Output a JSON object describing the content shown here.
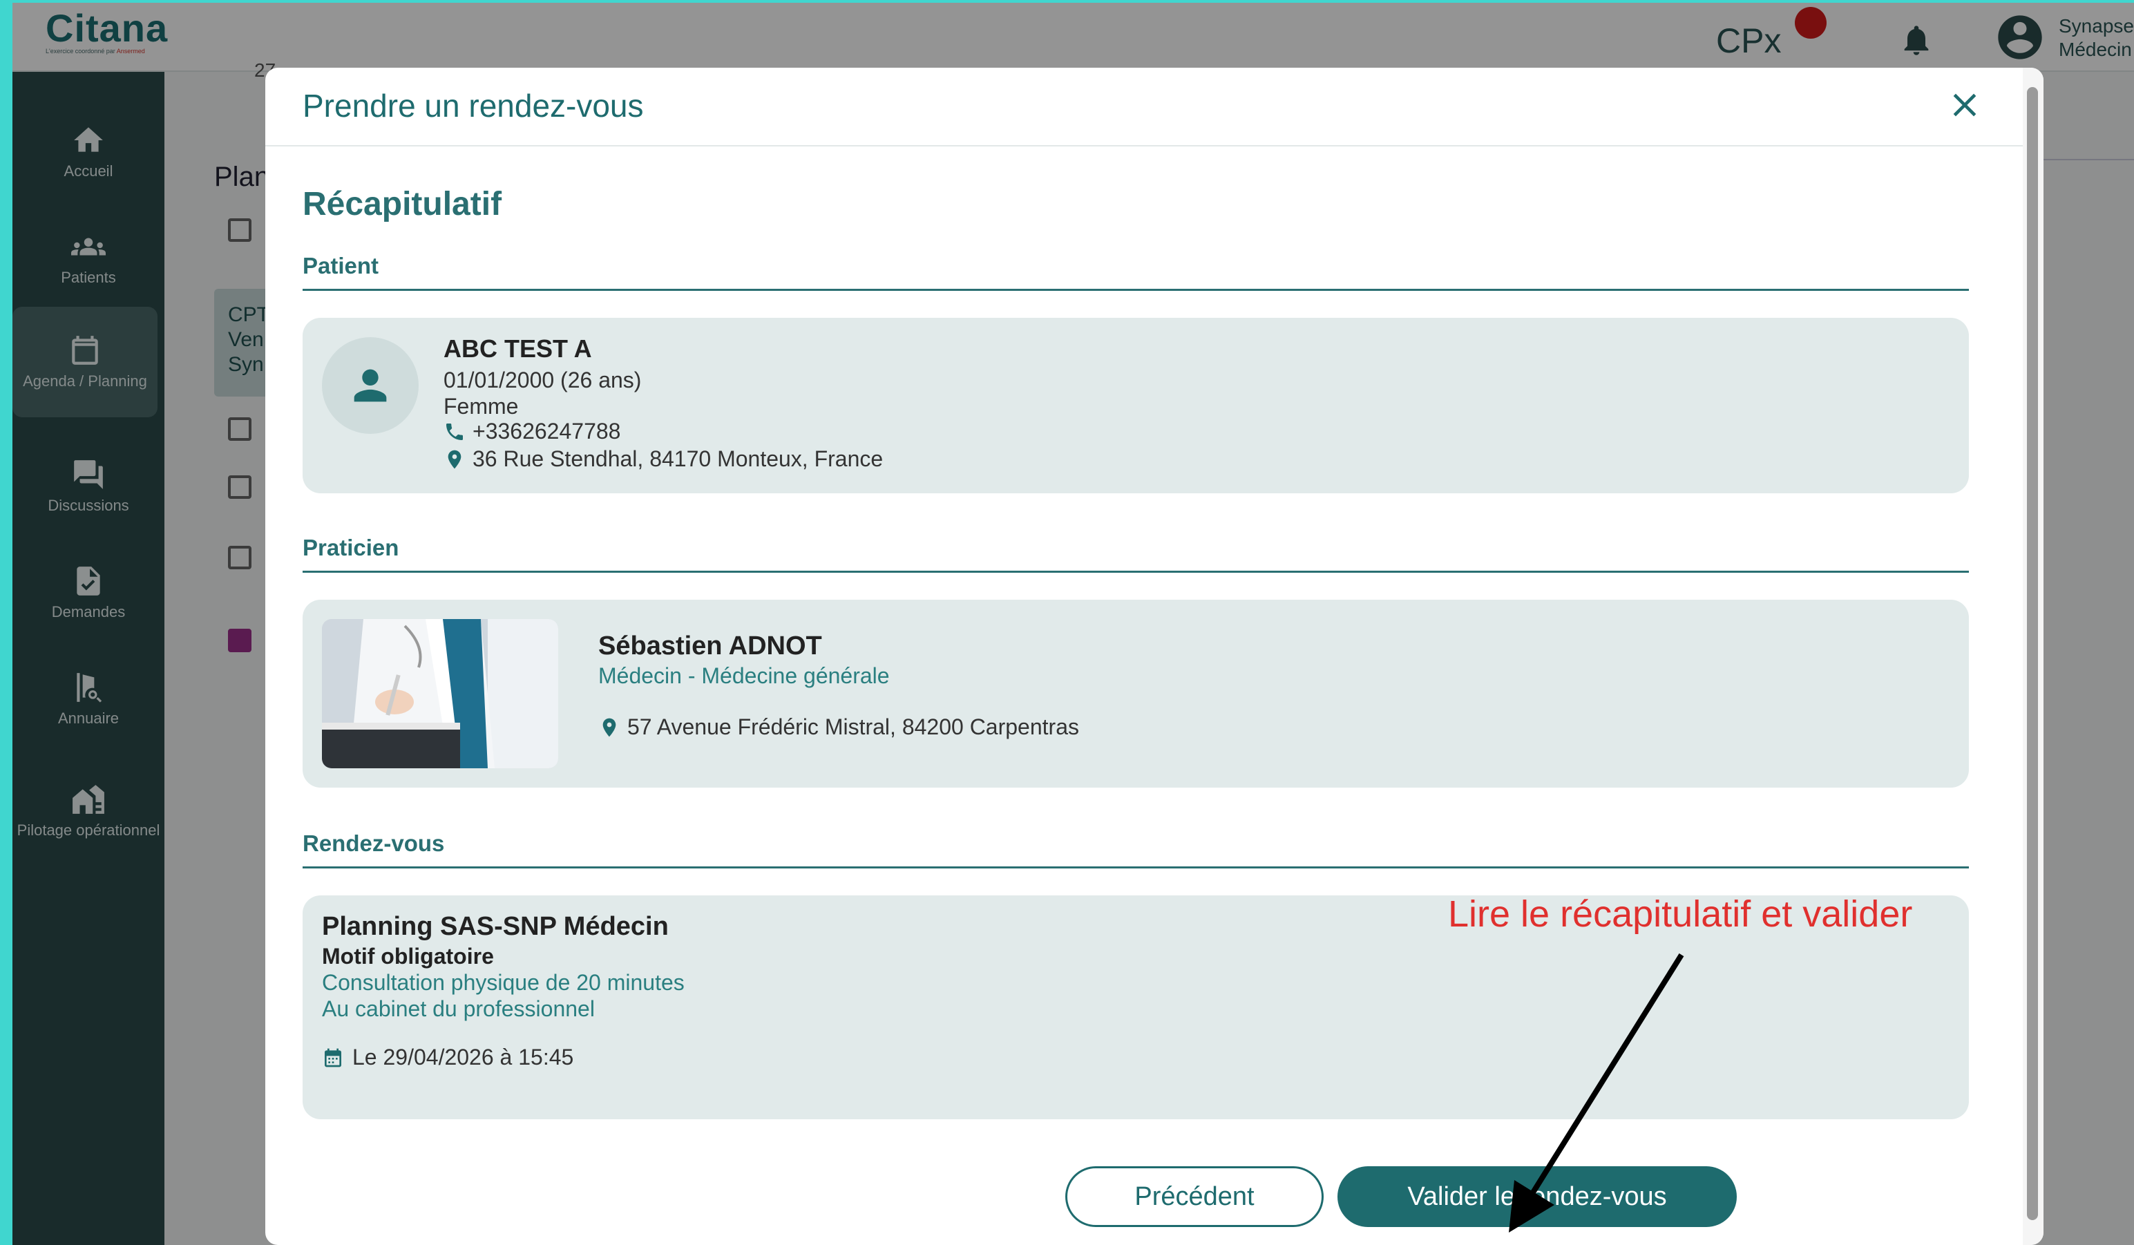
{
  "app": {
    "logo_name": "Citana",
    "logo_tagline": "L'exercice coordonné par",
    "logo_brand": "Ansermed"
  },
  "topbar": {
    "cpx_label": "CPx",
    "user_name": "Synapse",
    "user_role": "Médecin"
  },
  "sidebar": {
    "items": [
      {
        "label": "Accueil",
        "icon": "home-icon"
      },
      {
        "label": "Patients",
        "icon": "people-icon"
      },
      {
        "label": "Agenda / Planning",
        "icon": "calendar-icon",
        "active": true
      },
      {
        "label": "Discussions",
        "icon": "chat-icon"
      },
      {
        "label": "Demandes",
        "icon": "document-icon"
      },
      {
        "label": "Annuaire",
        "icon": "directory-icon"
      },
      {
        "label": "Pilotage opérationnel",
        "icon": "buildings-icon"
      }
    ]
  },
  "background": {
    "title": "Plan",
    "card_lines": [
      "CPT",
      "Ven",
      "Syn"
    ],
    "date_fragment": "27"
  },
  "modal": {
    "title": "Prendre un rendez-vous",
    "section_title": "Récapitulatif",
    "patient": {
      "label": "Patient",
      "name": "ABC TEST A",
      "birth": "01/01/2000 (26 ans)",
      "sex": "Femme",
      "phone": "+33626247788",
      "address": "36 Rue Stendhal, 84170 Monteux, France"
    },
    "practitioner": {
      "label": "Praticien",
      "name": "Sébastien ADNOT",
      "specialty": "Médecin - Médecine générale",
      "address": "57 Avenue Frédéric Mistral, 84200 Carpentras"
    },
    "appointment": {
      "label": "Rendez-vous",
      "planning": "Planning SAS-SNP Médecin",
      "motif_label": "Motif obligatoire",
      "consultation": "Consultation physique de 20 minutes",
      "location": "Au cabinet du professionnel",
      "datetime": "Le 29/04/2026 à 15:45"
    },
    "buttons": {
      "previous": "Précédent",
      "validate": "Valider le rendez-vous"
    }
  },
  "annotation": {
    "text": "Lire le récapitulatif et valider",
    "color": "#e0302e"
  },
  "colors": {
    "primary": "#1e6b6e",
    "sidebar": "#2c4a4a",
    "card": "#e1eaea",
    "notification": "#d11a1a"
  }
}
